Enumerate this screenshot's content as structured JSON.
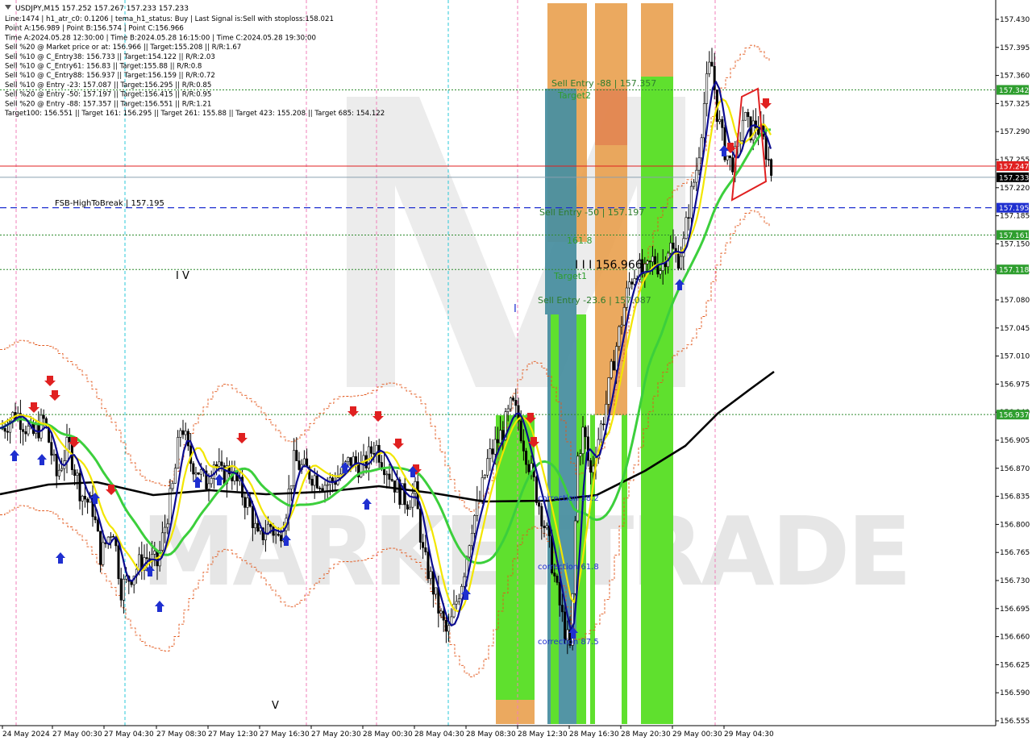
{
  "chart_data": {
    "type": "candlestick",
    "symbol_line": "USDJPY,M15  157.252 157.267 157.233 157.233",
    "info_lines": [
      "Line:1474  |  h1_atr_c0: 0.1206  |  tema_h1_status: Buy  |  Last Signal is:Sell with stoploss:158.021",
      "Point A:156.989  |  Point B:156.574  |  Point C:156.966",
      "Time A:2024.05.28 12:30:00  |  Time B:2024.05.28 16:15:00  |  Time C:2024.05.28 19:30:00",
      "Sell %20 @ Market price or at: 156.966  ||  Target:155.208  ||  R/R:1.67",
      "Sell %10 @ C_Entry38: 156.733  ||  Target:154.122  ||  R/R:2.03",
      "Sell %10 @ C_Entry61: 156.83  ||  Target:155.88  ||  R/R:0.8",
      "Sell %10 @ C_Entry88: 156.937  ||  Target:156.159  ||  R/R:0.72",
      "Sell %10 @ Entry -23: 157.087  ||  Target:156.295  ||  R/R:0.85",
      "Sell %20 @ Entry -50: 157.197  ||  Target:156.415  ||  R/R:0.95",
      "Sell %20 @ Entry -88: 157.357  ||  Target:156.551  ||  R/R:1.21",
      "Target100: 156.551  ||  Target 161: 156.295  ||  Target 261: 155.88  ||  Target 423: 155.208  ||  Target 685: 154.122"
    ],
    "y_axis": {
      "min": 156.545,
      "max": 157.455,
      "ticks": [
        "157.430",
        "157.395",
        "157.360",
        "157.325",
        "157.290",
        "157.255",
        "157.220",
        "157.185",
        "157.150",
        "157.115",
        "157.080",
        "157.045",
        "157.010",
        "156.975",
        "156.940",
        "156.905",
        "156.870",
        "156.835",
        "156.800",
        "156.765",
        "156.730",
        "156.695",
        "156.660",
        "156.625",
        "156.590",
        "156.555"
      ]
    },
    "x_axis": {
      "labels": [
        "24 May 2024",
        "27 May 00:30",
        "27 May 04:30",
        "27 May 08:30",
        "27 May 12:30",
        "27 May 16:30",
        "27 May 20:30",
        "28 May 00:30",
        "28 May 04:30",
        "28 May 08:30",
        "28 May 12:30",
        "28 May 16:30",
        "28 May 20:30",
        "29 May 00:30",
        "29 May 04:30"
      ]
    },
    "price_tags": [
      {
        "value": "157.342",
        "price": 157.342,
        "color": "#2e9e2e"
      },
      {
        "value": "157.247",
        "price": 157.247,
        "color": "#e02020"
      },
      {
        "value": "157.233",
        "price": 157.233,
        "color": "#000000"
      },
      {
        "value": "157.195",
        "price": 157.195,
        "color": "#1f2fd0"
      },
      {
        "value": "157.161",
        "price": 157.161,
        "color": "#2e9e2e"
      },
      {
        "value": "157.118",
        "price": 157.118,
        "color": "#2e9e2e"
      },
      {
        "value": "156.937",
        "price": 156.937,
        "color": "#2e9e2e"
      }
    ],
    "levels": [
      {
        "price": 157.342,
        "style": "green-dotted"
      },
      {
        "price": 157.247,
        "style": "red-solid"
      },
      {
        "price": 157.233,
        "style": "gray-solid"
      },
      {
        "price": 157.195,
        "style": "blue-dashed"
      },
      {
        "price": 157.161,
        "style": "green-dotted"
      },
      {
        "price": 157.118,
        "style": "green-dotted"
      },
      {
        "price": 156.937,
        "style": "green-dotted"
      }
    ],
    "annotations": [
      {
        "text": "FSB-HighToBreak | 157.195",
        "color": "#000000"
      },
      {
        "text": "Sell Entry -88 | 157.357",
        "color": "#2e7d2e"
      },
      {
        "text": "Target2",
        "color": "#2e9e2e"
      },
      {
        "text": "Sell Entry -50 | 157.197",
        "color": "#2e7d2e"
      },
      {
        "text": "161.8",
        "color": "#2e9e2e"
      },
      {
        "text": "I I I 156.966",
        "color": "#000000"
      },
      {
        "text": "Target1",
        "color": "#2e9e2e"
      },
      {
        "text": "Sell Entry -23.6 | 157.087",
        "color": "#2e7d2e"
      },
      {
        "text": "correction 38.2",
        "color": "#1f2fd0"
      },
      {
        "text": "correction 61.8",
        "color": "#1f2fd0"
      },
      {
        "text": "correction 87.5",
        "color": "#1f2fd0"
      },
      {
        "text": "I V",
        "color": "#000000"
      },
      {
        "text": "V",
        "color": "#000000"
      },
      {
        "text": "I",
        "color": "#1f2fd0"
      }
    ],
    "watermark": "MARKETTRADE",
    "colors": {
      "bullish_body": "#ffffff",
      "bearish_body": "#000000",
      "fast_ma": "#0b0b8f",
      "mid_ma": "#f2e600",
      "slow_ma": "#3ccf3c",
      "long_ma": "#000000",
      "envelope": "#e2571b",
      "zone_orange": "#e9a04e",
      "zone_green": "#5fe02e",
      "zone_teal": "#4a8fa0"
    }
  }
}
